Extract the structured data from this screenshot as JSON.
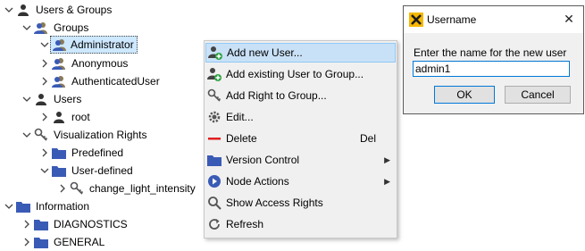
{
  "tree": {
    "items": [
      {
        "label": "Users & Groups"
      },
      {
        "label": "Groups"
      },
      {
        "label": "Administrator"
      },
      {
        "label": "Anonymous"
      },
      {
        "label": "AuthenticatedUser"
      },
      {
        "label": "Users"
      },
      {
        "label": "root"
      },
      {
        "label": "Visualization Rights"
      },
      {
        "label": "Predefined"
      },
      {
        "label": "User-defined"
      },
      {
        "label": "change_light_intensity"
      },
      {
        "label": "Information"
      },
      {
        "label": "DIAGNOSTICS"
      },
      {
        "label": "GENERAL"
      }
    ]
  },
  "context_menu": {
    "items": [
      {
        "label": "Add new User..."
      },
      {
        "label": "Add existing User to Group..."
      },
      {
        "label": "Add Right to Group..."
      },
      {
        "label": "Edit..."
      },
      {
        "label": "Delete",
        "shortcut": "Del"
      },
      {
        "label": "Version Control"
      },
      {
        "label": "Node Actions"
      },
      {
        "label": "Show Access Rights"
      },
      {
        "label": "Refresh"
      }
    ]
  },
  "dialog": {
    "title": "Username",
    "prompt": "Enter the name for the new user",
    "input_value": "admin1",
    "ok_label": "OK",
    "cancel_label": "Cancel"
  },
  "colors": {
    "folder": "#3a5bb5",
    "selection": "#cde8ff",
    "menu_highlight": "#c9e1f7",
    "delete_red": "#e02020",
    "dialog_accent": "#0078d7"
  }
}
